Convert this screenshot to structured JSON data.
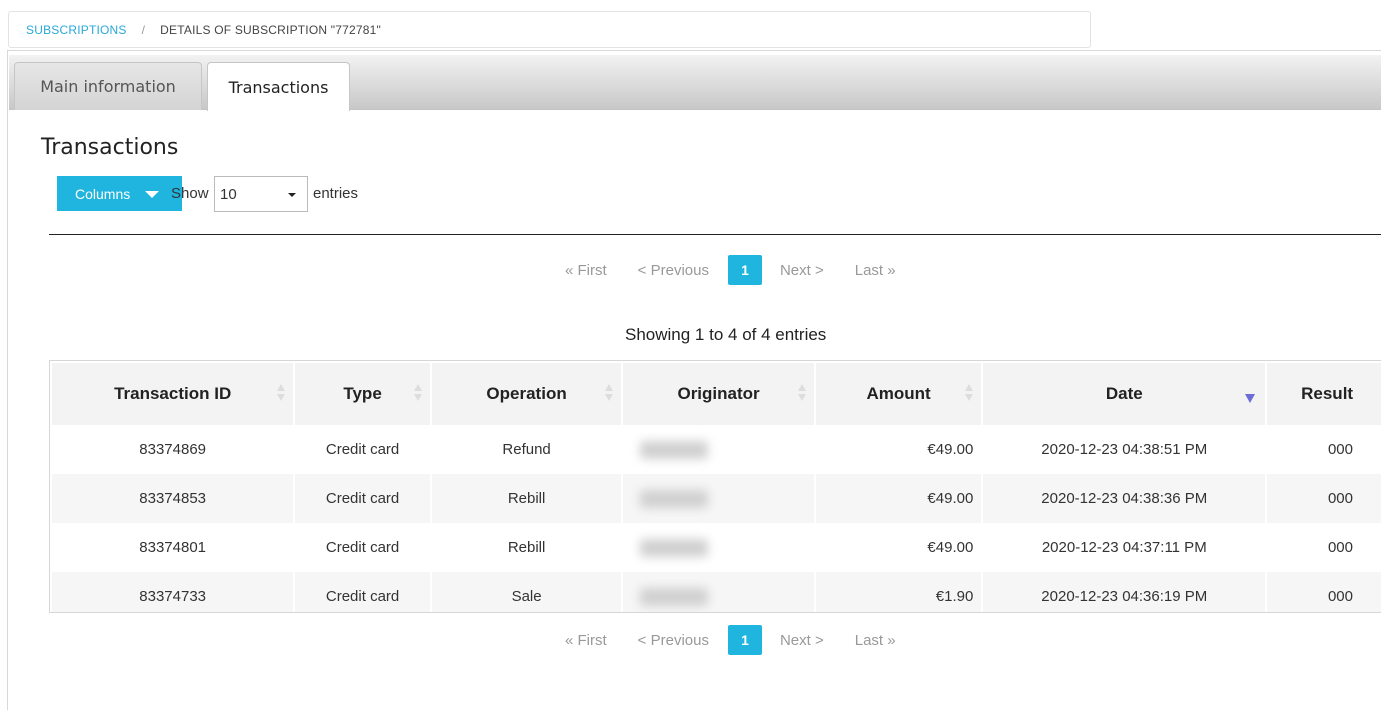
{
  "breadcrumb": {
    "link": "SUBSCRIPTIONS",
    "separator": "/",
    "current": "DETAILS OF SUBSCRIPTION \"772781\""
  },
  "tabs": {
    "main": "Main information",
    "transactions": "Transactions"
  },
  "section": {
    "title": "Transactions",
    "columns_button": "Columns",
    "show_label": "Show",
    "entries_value": "10",
    "entries_label": "entries",
    "info": "Showing 1 to 4 of 4 entries"
  },
  "pager": {
    "first": "« First",
    "previous": "< Previous",
    "current_page": "1",
    "next": "Next >",
    "last": "Last »"
  },
  "table": {
    "headers": [
      "Transaction ID",
      "Type",
      "Operation",
      "Originator",
      "Amount",
      "Date",
      "Result"
    ],
    "sorted_column": "Date",
    "sort_direction": "descending",
    "rows": [
      {
        "id": "83374869",
        "type": "Credit card",
        "operation": "Refund",
        "amount": "€49.00",
        "date": "2020-12-23 04:38:51 PM",
        "result": "000"
      },
      {
        "id": "83374853",
        "type": "Credit card",
        "operation": "Rebill",
        "amount": "€49.00",
        "date": "2020-12-23 04:38:36 PM",
        "result": "000"
      },
      {
        "id": "83374801",
        "type": "Credit card",
        "operation": "Rebill",
        "amount": "€49.00",
        "date": "2020-12-23 04:37:11 PM",
        "result": "000"
      },
      {
        "id": "83374733",
        "type": "Credit card",
        "operation": "Sale",
        "amount": "€1.90",
        "date": "2020-12-23 04:36:19 PM",
        "result": "000"
      }
    ]
  },
  "colors": {
    "accent": "#1fb5de",
    "link": "#2aa8d8",
    "sort_indicator": "#6c6cd6"
  }
}
